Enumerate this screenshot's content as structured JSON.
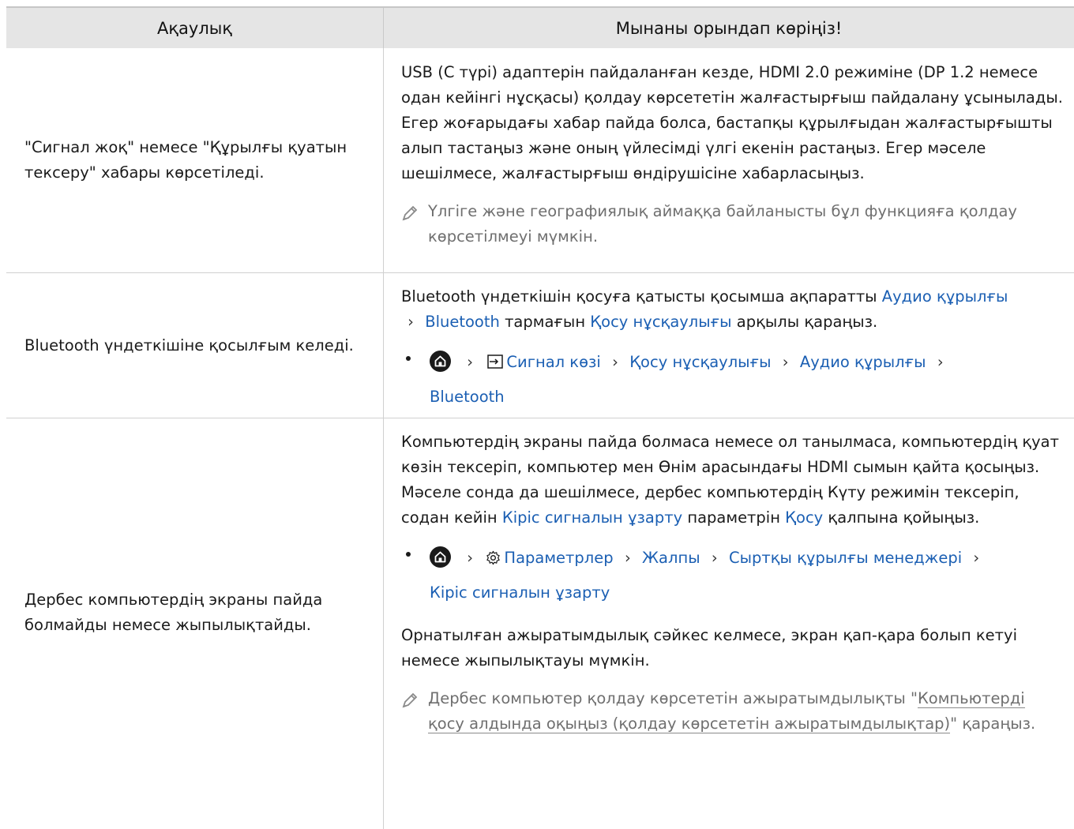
{
  "table": {
    "headers": {
      "problem": "Ақаулық",
      "solution": "Мынаны орындап көріңіз!"
    },
    "rows": [
      {
        "problem": "\"Сигнал жоқ\" немесе \"Құрылғы қуатын тексеру\" хабары көрсетіледі.",
        "solution_text": "USB (C түрі) адаптерін пайдаланған кезде, HDMI 2.0 режиміне (DP 1.2 немесе одан кейінгі нұсқасы) қолдау көрсететін жалғастырғыш пайдалану ұсынылады. Егер жоғарыдағы хабар пайда болса, бастапқы құрылғыдан жалғастырғышты алып тастаңыз және оның үйлесімді үлгі екенін растаңыз. Егер мәселе шешілмесе, жалғастырғыш өндірушісіне хабарласыңыз.",
        "note": "Үлгіге және географиялық аймаққа байланысты бұл функцияға қолдау көрсетілмеуі мүмкін."
      },
      {
        "problem": "Bluetooth үндеткішіне қосылғым келеді.",
        "text_a": "Bluetooth үндеткішін қосуға қатысты қосымша ақпаратты",
        "link_a": "Аудио құрылғы",
        "link_b": "Bluetooth",
        "text_b": "тармағын",
        "link_c": "Қосу нұсқаулығы",
        "text_c": "арқылы қараңыз.",
        "path": {
          "source": "Сигнал көзі",
          "guide": "Қосу нұсқаулығы",
          "audio": "Аудио құрылғы",
          "bt": "Bluetooth"
        }
      },
      {
        "problem": "Дербес компьютердің экраны пайда болмайды немесе жыпылықтайды.",
        "text_a": "Компьютердің экраны пайда болмаса немесе ол танылмаса, компьютердің қуат көзін тексеріп, компьютер мен Өнім арасындағы HDMI сымын қайта қосыңыз. Мәселе сонда да шешілмесе, дербес компьютердің Күту режимін тексеріп, содан кейін",
        "link_a": "Кіріс сигналын ұзарту",
        "text_b": "параметрін",
        "link_b": "Қосу",
        "text_c": "қалпына қойыңыз.",
        "path": {
          "settings": "Параметрлер",
          "general": "Жалпы",
          "external": "Сыртқы құрылғы менеджері",
          "input": "Кіріс сигналын ұзарту"
        },
        "para2": "Орнатылған ажыратымдылық сәйкес келмесе, экран қап-қара болып кетуі немесе жыпылықтауы мүмкін.",
        "note_a": "Дербес компьютер қолдау көрсететін ажыратымдылықты \"",
        "note_link": "Компьютерді қосу алдында оқыңыз (қолдау көрсететін ажыратымдылықтар)",
        "note_b": "\" қараңыз."
      }
    ]
  }
}
